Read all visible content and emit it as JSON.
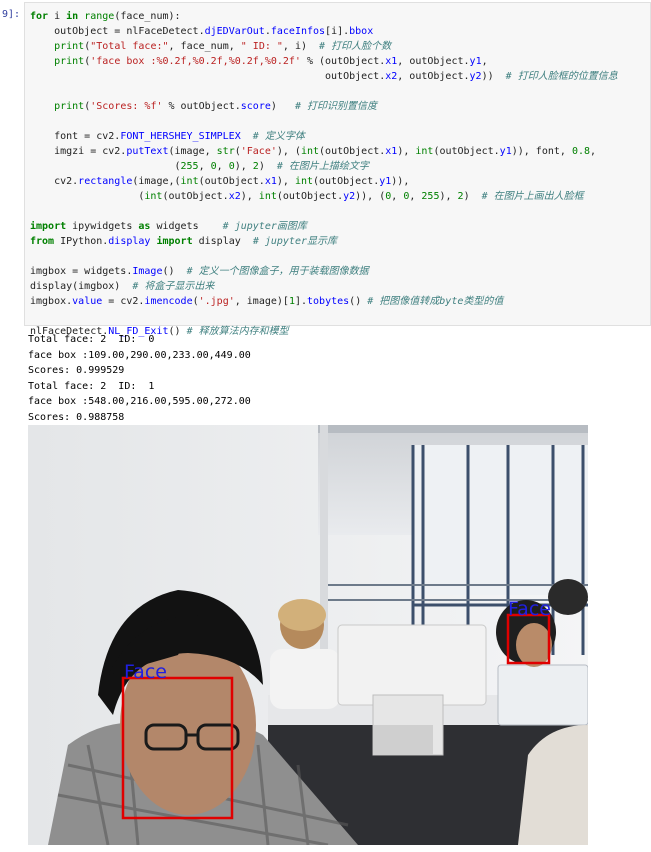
{
  "cell": {
    "prompt": "9]:",
    "code_lines": [
      [
        {
          "t": "for",
          "c": "kw"
        },
        {
          "t": " i "
        },
        {
          "t": "in",
          "c": "kw"
        },
        {
          "t": " "
        },
        {
          "t": "range",
          "c": "nb"
        },
        {
          "t": "(face_num):"
        }
      ],
      [
        {
          "t": "    outObject = nlFaceDetect."
        },
        {
          "t": "djEDVarOut",
          "c": "fn"
        },
        {
          "t": "."
        },
        {
          "t": "faceInfos",
          "c": "fn"
        },
        {
          "t": "[i]."
        },
        {
          "t": "bbox",
          "c": "fn"
        }
      ],
      [
        {
          "t": "    "
        },
        {
          "t": "print",
          "c": "nb"
        },
        {
          "t": "("
        },
        {
          "t": "\"Total face:\"",
          "c": "str"
        },
        {
          "t": ", face_num, "
        },
        {
          "t": "\" ID: \"",
          "c": "str"
        },
        {
          "t": ", i)  "
        },
        {
          "t": "# 打印人脸个数",
          "c": "cm"
        }
      ],
      [
        {
          "t": "    "
        },
        {
          "t": "print",
          "c": "nb"
        },
        {
          "t": "("
        },
        {
          "t": "'face box :%0.2f,%0.2f,%0.2f,%0.2f'",
          "c": "str"
        },
        {
          "t": " % (outObject."
        },
        {
          "t": "x1",
          "c": "fn"
        },
        {
          "t": ", outObject."
        },
        {
          "t": "y1",
          "c": "fn"
        },
        {
          "t": ","
        }
      ],
      [
        {
          "t": "                                                 outObject."
        },
        {
          "t": "x2",
          "c": "fn"
        },
        {
          "t": ", outObject."
        },
        {
          "t": "y2",
          "c": "fn"
        },
        {
          "t": "))  "
        },
        {
          "t": "# 打印人脸框的位置信息",
          "c": "cm"
        }
      ],
      [
        {
          "t": ""
        }
      ],
      [
        {
          "t": "    "
        },
        {
          "t": "print",
          "c": "nb"
        },
        {
          "t": "("
        },
        {
          "t": "'Scores: %f'",
          "c": "str"
        },
        {
          "t": " % outObject."
        },
        {
          "t": "score",
          "c": "fn"
        },
        {
          "t": ")   "
        },
        {
          "t": "# 打印识别置信度",
          "c": "cm"
        }
      ],
      [
        {
          "t": ""
        }
      ],
      [
        {
          "t": "    font = cv2."
        },
        {
          "t": "FONT_HERSHEY_SIMPLEX",
          "c": "fn"
        },
        {
          "t": "  "
        },
        {
          "t": "# 定义字体",
          "c": "cm"
        }
      ],
      [
        {
          "t": "    imgzi = cv2."
        },
        {
          "t": "putText",
          "c": "fn"
        },
        {
          "t": "(image, "
        },
        {
          "t": "str",
          "c": "nb"
        },
        {
          "t": "("
        },
        {
          "t": "'Face'",
          "c": "str"
        },
        {
          "t": "), ("
        },
        {
          "t": "int",
          "c": "nb"
        },
        {
          "t": "(outObject."
        },
        {
          "t": "x1",
          "c": "fn"
        },
        {
          "t": "), "
        },
        {
          "t": "int",
          "c": "nb"
        },
        {
          "t": "(outObject."
        },
        {
          "t": "y1",
          "c": "fn"
        },
        {
          "t": ")), font, "
        },
        {
          "t": "0.8",
          "c": "num"
        },
        {
          "t": ","
        }
      ],
      [
        {
          "t": "                        ("
        },
        {
          "t": "255",
          "c": "num"
        },
        {
          "t": ", "
        },
        {
          "t": "0",
          "c": "num"
        },
        {
          "t": ", "
        },
        {
          "t": "0",
          "c": "num"
        },
        {
          "t": "), "
        },
        {
          "t": "2",
          "c": "num"
        },
        {
          "t": ")  "
        },
        {
          "t": "# 在图片上描绘文字",
          "c": "cm"
        }
      ],
      [
        {
          "t": "    cv2."
        },
        {
          "t": "rectangle",
          "c": "fn"
        },
        {
          "t": "(image,("
        },
        {
          "t": "int",
          "c": "nb"
        },
        {
          "t": "(outObject."
        },
        {
          "t": "x1",
          "c": "fn"
        },
        {
          "t": "), "
        },
        {
          "t": "int",
          "c": "nb"
        },
        {
          "t": "(outObject."
        },
        {
          "t": "y1",
          "c": "fn"
        },
        {
          "t": ")),"
        }
      ],
      [
        {
          "t": "                  ("
        },
        {
          "t": "int",
          "c": "nb"
        },
        {
          "t": "(outObject."
        },
        {
          "t": "x2",
          "c": "fn"
        },
        {
          "t": "), "
        },
        {
          "t": "int",
          "c": "nb"
        },
        {
          "t": "(outObject."
        },
        {
          "t": "y2",
          "c": "fn"
        },
        {
          "t": ")), ("
        },
        {
          "t": "0",
          "c": "num"
        },
        {
          "t": ", "
        },
        {
          "t": "0",
          "c": "num"
        },
        {
          "t": ", "
        },
        {
          "t": "255",
          "c": "num"
        },
        {
          "t": "), "
        },
        {
          "t": "2",
          "c": "num"
        },
        {
          "t": ")  "
        },
        {
          "t": "# 在图片上画出人脸框",
          "c": "cm"
        }
      ],
      [
        {
          "t": ""
        }
      ],
      [
        {
          "t": "import",
          "c": "kw"
        },
        {
          "t": " ipywidgets "
        },
        {
          "t": "as",
          "c": "kw"
        },
        {
          "t": " widgets    "
        },
        {
          "t": "# jupyter画图库",
          "c": "cm"
        }
      ],
      [
        {
          "t": "from",
          "c": "kw"
        },
        {
          "t": " IPython."
        },
        {
          "t": "display",
          "c": "fn"
        },
        {
          "t": " "
        },
        {
          "t": "import",
          "c": "kw"
        },
        {
          "t": " display  "
        },
        {
          "t": "# jupyter显示库",
          "c": "cm"
        }
      ],
      [
        {
          "t": ""
        }
      ],
      [
        {
          "t": "imgbox = widgets."
        },
        {
          "t": "Image",
          "c": "fn"
        },
        {
          "t": "()  "
        },
        {
          "t": "# 定义一个图像盒子，用于装载图像数据",
          "c": "cm"
        }
      ],
      [
        {
          "t": "display(imgbox)  "
        },
        {
          "t": "# 将盒子显示出来",
          "c": "cm"
        }
      ],
      [
        {
          "t": "imgbox."
        },
        {
          "t": "value",
          "c": "fn"
        },
        {
          "t": " = cv2."
        },
        {
          "t": "imencode",
          "c": "fn"
        },
        {
          "t": "("
        },
        {
          "t": "'.jpg'",
          "c": "str"
        },
        {
          "t": ", image)["
        },
        {
          "t": "1",
          "c": "num"
        },
        {
          "t": "]."
        },
        {
          "t": "tobytes",
          "c": "fn"
        },
        {
          "t": "() "
        },
        {
          "t": "# 把图像值转成byte类型的值",
          "c": "cm"
        }
      ],
      [
        {
          "t": ""
        }
      ],
      [
        {
          "t": "nlFaceDetect."
        },
        {
          "t": "NL_FD_Exit",
          "c": "fn"
        },
        {
          "t": "() "
        },
        {
          "t": "# 释放算法内存和模型",
          "c": "cm"
        }
      ]
    ]
  },
  "output": {
    "lines": [
      "Total face: 2  ID:  0",
      "face box :109.00,290.00,233.00,449.00",
      "Scores: 0.999529",
      "Total face: 2  ID:  1",
      "face box :548.00,216.00,595.00,272.00",
      "Scores: 0.988758"
    ]
  },
  "image": {
    "face_label": "Face",
    "box_color": "#e00000",
    "label_color": "#2020e0"
  },
  "colors": {
    "prompt": "#303f9f",
    "cell_bg": "#f7f7f7",
    "keyword": "#008000",
    "string": "#ba2121",
    "comment": "#408080",
    "attribute": "#0000ff"
  }
}
